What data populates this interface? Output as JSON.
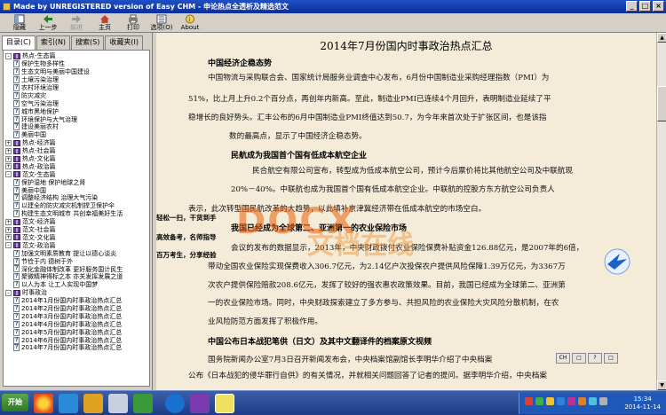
{
  "window": {
    "title": "Made by UNREGISTERED version of Easy CHM - 申论热点全透析及精选范文"
  },
  "toolbar": {
    "buttons": [
      {
        "label": "隐藏",
        "icon": "hide-icon",
        "enabled": true
      },
      {
        "label": "上一步",
        "icon": "back-icon",
        "enabled": true
      },
      {
        "label": "前进",
        "icon": "forward-icon",
        "enabled": false
      },
      {
        "label": "主页",
        "icon": "home-icon",
        "enabled": true
      },
      {
        "label": "打印",
        "icon": "print-icon",
        "enabled": true
      },
      {
        "label": "选项(O)",
        "icon": "options-icon",
        "enabled": true
      },
      {
        "label": "About",
        "icon": "about-icon",
        "enabled": true
      }
    ]
  },
  "nav": {
    "tabs": [
      "目录(C)",
      "索引(N)",
      "搜索(S)",
      "收藏夹(I)"
    ],
    "tree": [
      {
        "label": "热点-生态篇",
        "type": "book",
        "exp": "-",
        "level": 0
      },
      {
        "label": "保护生物多样性",
        "type": "page",
        "level": 1
      },
      {
        "label": "生态文明与美丽中国建设",
        "type": "page",
        "level": 1
      },
      {
        "label": "土壤污染治理",
        "type": "page",
        "level": 1
      },
      {
        "label": "农村环境治理",
        "type": "page",
        "level": 1
      },
      {
        "label": "防灾减灾",
        "type": "page",
        "level": 1
      },
      {
        "label": "空气污染治理",
        "type": "page",
        "level": 1
      },
      {
        "label": "城市黑地保护",
        "type": "page",
        "level": 1
      },
      {
        "label": "环境保护与大气治理",
        "type": "page",
        "level": 1
      },
      {
        "label": "建设美丽农村",
        "type": "page",
        "level": 1
      },
      {
        "label": "美丽中国",
        "type": "page",
        "level": 1
      },
      {
        "label": "热点-经济篇",
        "type": "book",
        "exp": "+",
        "level": 0
      },
      {
        "label": "热点-社会篇",
        "type": "book",
        "exp": "+",
        "level": 0
      },
      {
        "label": "热点-文化篇",
        "type": "book",
        "exp": "+",
        "level": 0
      },
      {
        "label": "热点-政治篇",
        "type": "book",
        "exp": "+",
        "level": 0
      },
      {
        "label": "范文-生态篇",
        "type": "book",
        "exp": "-",
        "level": 0
      },
      {
        "label": "保护湿地 保护地球之肾",
        "type": "page",
        "level": 1
      },
      {
        "label": "美丽中国",
        "type": "page",
        "level": 1
      },
      {
        "label": "调整经济结构 治理大气污染",
        "type": "page",
        "level": 1
      },
      {
        "label": "以建全的防灾减灾机制捍卫保护伞",
        "type": "page",
        "level": 1
      },
      {
        "label": "构建生态文明城市 共创幸福美好生活",
        "type": "page",
        "level": 1
      },
      {
        "label": "范文-经济篇",
        "type": "book",
        "exp": "+",
        "level": 0
      },
      {
        "label": "范文-社会篇",
        "type": "book",
        "exp": "+",
        "level": 0
      },
      {
        "label": "范文-文化篇",
        "type": "book",
        "exp": "+",
        "level": 0
      },
      {
        "label": "范文-政治篇",
        "type": "book",
        "exp": "-",
        "level": 0
      },
      {
        "label": "加强文明素质教育 提让以德心谈炎",
        "type": "page",
        "level": 1
      },
      {
        "label": "节俭于内 德树于外",
        "type": "page",
        "level": 1
      },
      {
        "label": "深化金融体制改革 更好服务国计民生",
        "type": "page",
        "level": 1
      },
      {
        "label": "聚微精神得标之本 亦关发挥发展之道",
        "type": "page",
        "level": 1
      },
      {
        "label": "以人为本 让工人实现中国梦",
        "type": "page",
        "level": 1
      },
      {
        "label": "时事政治",
        "type": "book",
        "exp": "-",
        "level": 0
      },
      {
        "label": "2014年1月份国内时事政治热点汇总",
        "type": "page",
        "level": 1
      },
      {
        "label": "2014年2月份国内时事政治热点汇总",
        "type": "page",
        "level": 1
      },
      {
        "label": "2014年3月份国内时事政治热点汇总",
        "type": "page",
        "level": 1
      },
      {
        "label": "2014年4月份国内时事政治热点汇总",
        "type": "page",
        "level": 1
      },
      {
        "label": "2014年5月份国内时事政治热点汇总",
        "type": "page",
        "level": 1
      },
      {
        "label": "2014年6月份国内时事政治热点汇总",
        "type": "page",
        "level": 1
      },
      {
        "label": "2014年7月份国内时事政治热点汇总",
        "type": "page",
        "level": 1
      }
    ]
  },
  "doc": {
    "title": "2014年7月份国内时事政治热点汇总",
    "s1": "中国经济企稳态势",
    "p1a": "中国物流与采购联合会、国家统计局服务业调查中心发布，6月份中国制造业采购经理指数（PMI）为",
    "p1b": "51%，比上月上升0.2个百分点，再创年内新高。至此，制造业PMI已连续4个月回升，表明制造业延续了平",
    "p1c": "稳增长的良好势头。汇丰公布的6月中国制造业PMI终值达到50.7，为今年来首次处于扩张区间，也是该指",
    "p1d": "数的最高点，显示了中国经济企稳态势。",
    "s2": "民航成为我国首个国有低成本航空企业",
    "p2a": "民合航空有限公司宣布，转型成为低成本航空公司，预计今后票价将比其他航空公司及中联航现",
    "p2b": "20%－40%。中联航也成为我国首个国有低成本航空企业。中联航的控股方东方航空公司负责人",
    "p2c": "表示，此次转型国民航改革的大趋势，以此填补京津冀经济带在低成本航空的市场空白。",
    "s3": "我国已经成为全球第二、亚洲第一的农业保险市场",
    "p3a": "会议的发布的数据显示，2013年，中央财政拨付农业保险保费补贴资金126.88亿元，是2007年的6倍，",
    "p3b": "带动全国农业保险实现保费收入306.7亿元，为2.14亿户次投保农户提供风险保障1.39万亿元，为3367万",
    "p3c": "次农户提供保险赔款208.6亿元，发挥了较好的强农惠农政策效果。目前，我国已经成为全球第二、亚洲第",
    "p3d": "一的农业保险市场。同时，中央财政探索建立了多方参与、共担风险的农业保险大灾风险分散机制，在农",
    "p3e": "业风险防范方面发挥了积极作用。",
    "s4": "中国公布日本战犯笔供（日文）及其中文翻译件的档案原文视频",
    "p4a": "国务院新闻办公室7月3日召开新闻发布会，中央档案馆副馆长李明华介绍了中央档案",
    "p4b": "公布《日本战犯的侵华罪行自供》的有关情况，并就相关问题回答了记者的提问。据李明华介绍，中央档案",
    "watermark": "DOCX",
    "watermark2": "文档在线"
  },
  "overlay": {
    "a": "轻松一扫，干货到手",
    "b": "高效备考，名师指导",
    "c": "百万考生，分享经验"
  },
  "findbar": [
    "CH",
    "□",
    "?",
    "□"
  ],
  "taskbar": {
    "start": "开始",
    "time": "15:34",
    "date": "2014-11-14"
  }
}
